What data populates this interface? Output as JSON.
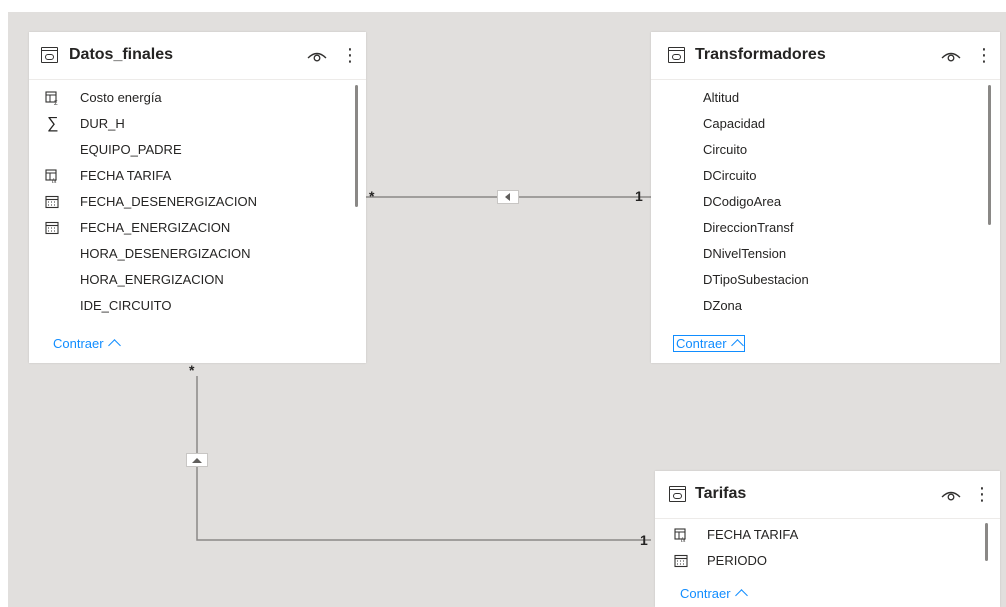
{
  "tables": [
    {
      "name": "Datos_finales",
      "fields": [
        {
          "label": "Costo energía",
          "icon": "calculated-table-icon"
        },
        {
          "label": "DUR_H",
          "icon": "sum-icon"
        },
        {
          "label": "EQUIPO_PADRE",
          "icon": ""
        },
        {
          "label": "FECHA TARIFA",
          "icon": "calculated-column-icon"
        },
        {
          "label": "FECHA_DESENERGIZACION",
          "icon": "calendar-icon"
        },
        {
          "label": "FECHA_ENERGIZACION",
          "icon": "calendar-icon"
        },
        {
          "label": "HORA_DESENERGIZACION",
          "icon": ""
        },
        {
          "label": "HORA_ENERGIZACION",
          "icon": ""
        },
        {
          "label": "IDE_CIRCUITO",
          "icon": ""
        }
      ],
      "collapse_label": "Contraer"
    },
    {
      "name": "Transformadores",
      "fields": [
        {
          "label": "Altitud",
          "icon": ""
        },
        {
          "label": "Capacidad",
          "icon": ""
        },
        {
          "label": "Circuito",
          "icon": ""
        },
        {
          "label": "DCircuito",
          "icon": ""
        },
        {
          "label": "DCodigoArea",
          "icon": ""
        },
        {
          "label": "DireccionTransf",
          "icon": ""
        },
        {
          "label": "DNivelTension",
          "icon": ""
        },
        {
          "label": "DTipoSubestacion",
          "icon": ""
        },
        {
          "label": "DZona",
          "icon": ""
        }
      ],
      "collapse_label": "Contraer"
    },
    {
      "name": "Tarifas",
      "fields": [
        {
          "label": "FECHA TARIFA",
          "icon": "calculated-column-icon"
        },
        {
          "label": "PERIODO",
          "icon": "calendar-icon"
        }
      ],
      "collapse_label": "Contraer"
    }
  ],
  "relationships": [
    {
      "from": "Datos_finales",
      "to": "Transformadores",
      "from_cardinality": "*",
      "to_cardinality": "1",
      "filter_direction": "left"
    },
    {
      "from": "Datos_finales",
      "to": "Tarifas",
      "from_cardinality": "*",
      "to_cardinality": "1",
      "filter_direction": "up"
    }
  ],
  "colors": {
    "canvas": "#e1dfdd",
    "card": "#ffffff",
    "accent": "#118dff",
    "text": "#252423",
    "line": "#8a8886"
  }
}
